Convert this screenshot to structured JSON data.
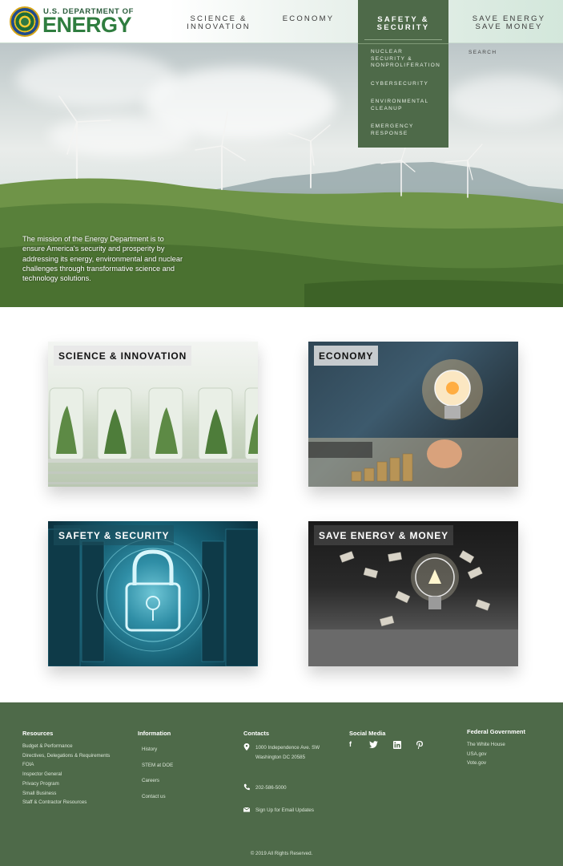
{
  "header": {
    "dept_line": "U.S. DEPARTMENT OF",
    "energy_word": "ENERGY",
    "nav": {
      "science": [
        "SCIENCE &",
        "INNOVATION"
      ],
      "economy": [
        "ECONOMY"
      ],
      "safety": [
        "SAFETY &",
        "SECURITY"
      ],
      "save": [
        "SAVE ENERGY",
        "SAVE MONEY"
      ]
    },
    "search": "SEARCH"
  },
  "dropdown": {
    "items": [
      [
        "NUCLEAR SECURITY &",
        "NONPROLIFERATION"
      ],
      [
        "CYBERSECURITY"
      ],
      [
        "ENVIRONMENTAL",
        "CLEANUP"
      ],
      [
        "EMERGENCY",
        "RESPONSE"
      ]
    ]
  },
  "hero": {
    "mission": "The mission of the Energy Department is to ensure America's security and prosperity by addressing its energy, environmental and nuclear challenges through transformative science and technology solutions."
  },
  "cards": {
    "science": "SCIENCE & INNOVATION",
    "economy": "ECONOMY",
    "safety": "SAFETY & SECURITY",
    "save": "SAVE ENERGY & MONEY"
  },
  "footer": {
    "resources": {
      "heading": "Resources",
      "links": [
        "Budget & Performance",
        "Directives, Delegations & Requirements",
        "FOIA",
        "Inspector General",
        "Privacy Program",
        "Small Business",
        "Staff & Contractor Resources"
      ]
    },
    "information": {
      "heading": "Information",
      "links": [
        "History",
        "STEM at DOE",
        "Careers",
        "Contact us"
      ]
    },
    "contacts": {
      "heading": "Contacts",
      "address_line1": "1000 Independence Ave. SW",
      "address_line2": "Washington DC 20585",
      "phone": "202-586-5000",
      "email": "Sign Up for Email Updates"
    },
    "social": {
      "heading": "Social Media",
      "icons": [
        "facebook-icon",
        "twitter-icon",
        "linkedin-icon",
        "pinterest-icon"
      ]
    },
    "federal": {
      "heading": "Federal Government",
      "links": [
        "The White House",
        "USA.gov",
        "Vote.gov"
      ]
    },
    "copyright": "© 2019 All Rights Reserved."
  },
  "colors": {
    "brand_green": "#4e6a49",
    "logo_green": "#2f7d3f"
  }
}
